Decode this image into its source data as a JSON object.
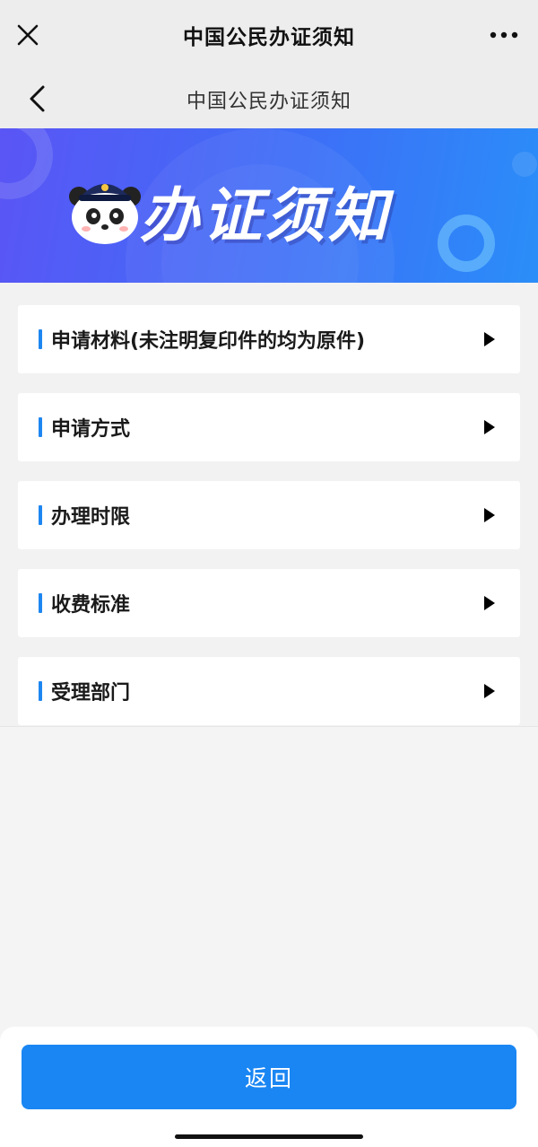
{
  "wechat_bar": {
    "title": "中国公民办证须知",
    "close_icon": "close-icon",
    "more_icon": "more-dots-icon"
  },
  "page_nav": {
    "title": "中国公民办证须知",
    "back_icon": "chevron-left-icon"
  },
  "banner": {
    "title": "办证须知",
    "mascot": "panda-police-mascot",
    "colors": {
      "start": "#5a55f5",
      "end": "#2a8ef8"
    }
  },
  "sections": [
    {
      "label": "申请材料(未注明复印件的均为原件)"
    },
    {
      "label": "申请方式"
    },
    {
      "label": "办理时限"
    },
    {
      "label": "收费标准"
    },
    {
      "label": "受理部门"
    }
  ],
  "footer": {
    "return_label": "返回",
    "accent": "#1a86f3"
  }
}
